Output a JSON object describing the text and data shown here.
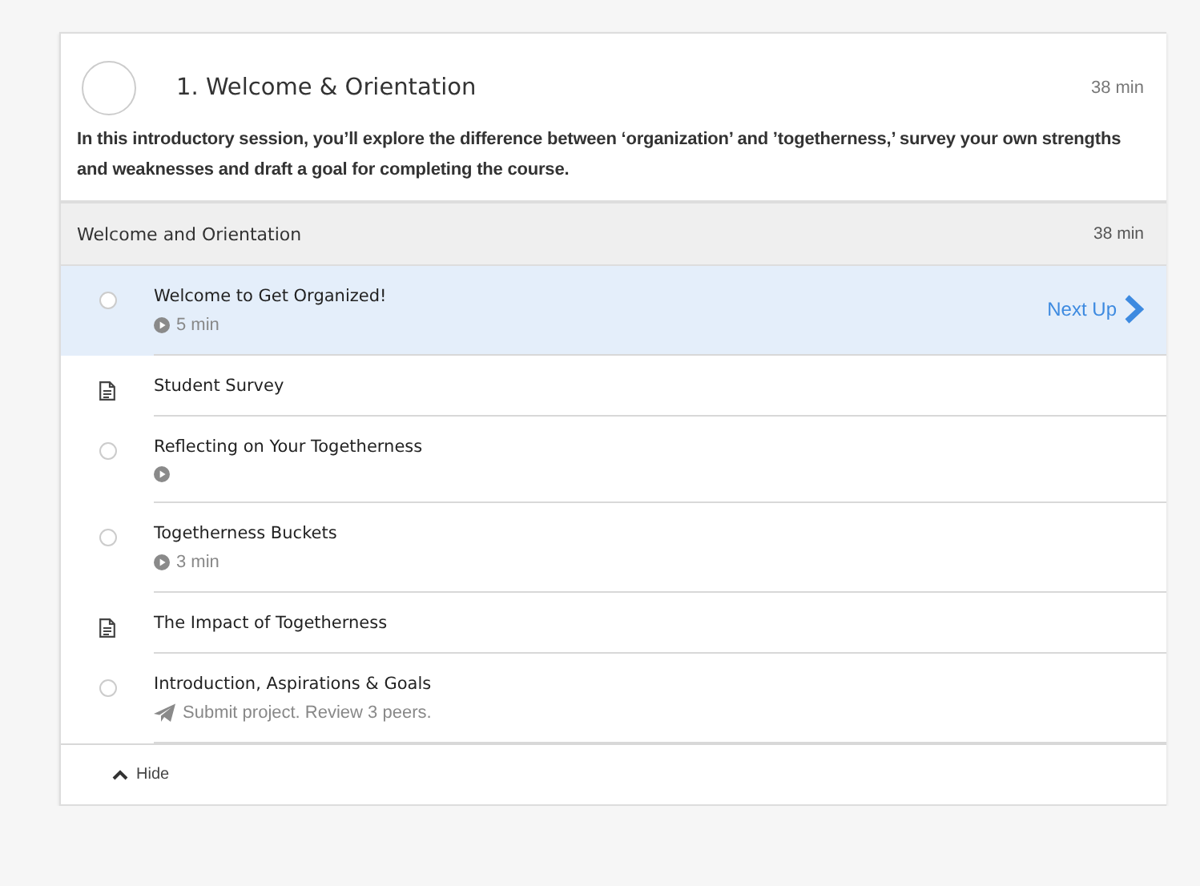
{
  "module": {
    "title": "1. Welcome & Orientation",
    "duration": "38 min",
    "description": "In this introductory session, you’ll explore the difference between ‘organization’ and ’togetherness,’ survey your own strengths and weaknesses and draft a goal for completing the course."
  },
  "section": {
    "title": "Welcome and Orientation",
    "duration": "38 min"
  },
  "items": [
    {
      "kind": "video",
      "title": "Welcome to Get Organized!",
      "meta": "5 min",
      "selected": true,
      "next_label": "Next Up"
    },
    {
      "kind": "reading",
      "title": "Student Survey",
      "selected": false
    },
    {
      "kind": "video",
      "title": "Reflecting on Your Togetherness",
      "selected": false
    },
    {
      "kind": "video",
      "title": "Togetherness Buckets",
      "meta": "3 min",
      "selected": false
    },
    {
      "kind": "reading",
      "title": "The Impact of Togetherness",
      "selected": false
    },
    {
      "kind": "peer",
      "title": "Introduction, Aspirations & Goals",
      "meta": "Submit project. Review 3 peers.",
      "selected": false
    }
  ],
  "hide_label": "Hide"
}
